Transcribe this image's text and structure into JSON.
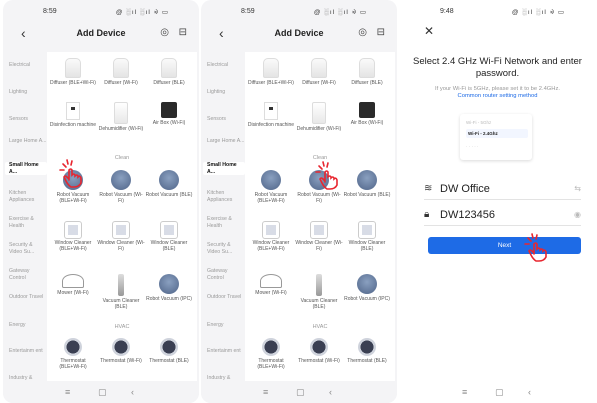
{
  "screen1": {
    "time": "8:59",
    "status_icons": "@ ░ıl ░ıl ⨵ ▭",
    "title": "Add Device",
    "categories": [
      "Electrical",
      "Lighting",
      "Sensors",
      "Large Home A...",
      "Small Home A...",
      "Kitchen Appliances",
      "Exercise & Health",
      "Security & Video Su...",
      "Gateway Control",
      "Outdoor Travel",
      "Energy",
      "Entertainm ent",
      "Industry &"
    ],
    "sections": {
      "clean": "Clean",
      "hvac": "HVAC"
    },
    "tiles": [
      "Diffuser (BLE+Wi-Fi)",
      "Diffuser (Wi-Fi)",
      "Diffuser (BLE)",
      "Disinfection machine",
      "Dehumidifier (Wi-Fi)",
      "Air Box (Wi-Fi)",
      "Robot Vacuum (BLE+Wi-Fi)",
      "Robot Vacuum (Wi-Fi)",
      "Robot Vacuum (BLE)",
      "Window Cleaner (BLE+Wi-Fi)",
      "Window Cleaner (Wi-Fi)",
      "Window Cleaner (BLE)",
      "Mower (Wi-Fi)",
      "Vacuum Cleaner (BLE)",
      "Robot Vacuum (IPC)",
      "Thermostat (BLE+Wi-Fi)",
      "Thermostat (Wi-Fi)",
      "Thermostat (BLE)"
    ]
  },
  "screen3": {
    "time": "9:48",
    "title": "Select 2.4 GHz Wi-Fi Network and enter password.",
    "hint": "If your Wi-Fi is 5GHz, please set it to be 2.4GHz.",
    "hint_link": "Common router setting method",
    "card_rows": [
      "Wi-Fi - 5Ghz",
      "Wi-Fi - 2.4Ghz",
      "· · · · ·"
    ],
    "wifi_name": "DW Office",
    "password": "DW123456",
    "next_label": "Next"
  },
  "colors": {
    "accent": "#1e6be6",
    "hand": "#e8262f"
  }
}
